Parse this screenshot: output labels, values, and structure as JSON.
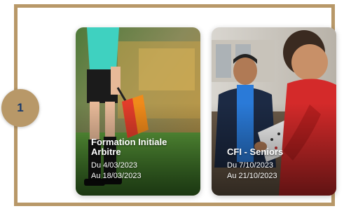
{
  "step": {
    "number": "1"
  },
  "cards": [
    {
      "title_line1": "Formation Initiale",
      "title_line2": "Arbitre",
      "date_from": "Du 4/03/2023",
      "date_to": "Au 18/03/2023"
    },
    {
      "title_line1": "CFI - Seniors",
      "title_line2": "",
      "date_from": "Du 7/10/2023",
      "date_to": "Au 21/10/2023"
    }
  ],
  "colors": {
    "frame": "#b89868",
    "badge_text": "#1a3a6b",
    "card_text": "#ffffff"
  },
  "icons": [
    "referee-photo",
    "coach-photo"
  ]
}
